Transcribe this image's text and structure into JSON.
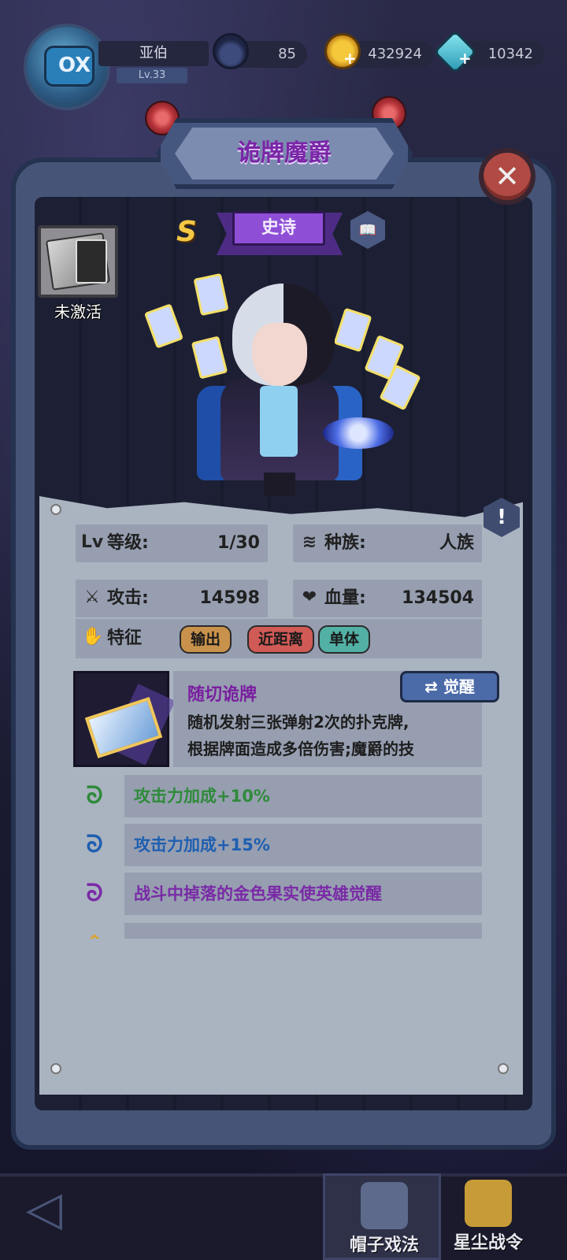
{
  "header": {
    "player_name": "亚伯",
    "player_level": "Lv.33",
    "avatar_text": "OX",
    "hat_count": "85",
    "gold": "432924",
    "gems": "10342"
  },
  "hero": {
    "name": "诡牌魔爵",
    "grade": "S",
    "rarity": "史诗",
    "equip_status": "未激活"
  },
  "stats": {
    "level_label": "等级:",
    "level_value": "1/30",
    "race_label": "种族:",
    "race_value": "人族",
    "attack_label": "攻击:",
    "attack_value": "14598",
    "hp_label": "血量:",
    "hp_value": "134504",
    "trait_label": "特征"
  },
  "traits": [
    "输出",
    "近距离",
    "单体"
  ],
  "skill": {
    "name": "随切诡牌",
    "awaken_label": "觉醒",
    "desc_line1": "随机发射三张弹射2次的扑克牌,",
    "desc_line2": "根据牌面造成多倍伤害;魔爵的技"
  },
  "bonuses": [
    {
      "text": "攻击力加成+10%",
      "color": "#2f8a3a"
    },
    {
      "text": "攻击力加成+15%",
      "color": "#1f5fb0"
    },
    {
      "text": "战斗中掉落的金色果实使英雄觉醒",
      "color": "#7a2aa6"
    }
  ],
  "nav": {
    "tab1": "帽子戏法",
    "tab2": "星尘战令"
  },
  "colors": {
    "title": "#7a26a6",
    "rarity_plate": "#8e4fd6",
    "panel": "#aab3c0"
  }
}
